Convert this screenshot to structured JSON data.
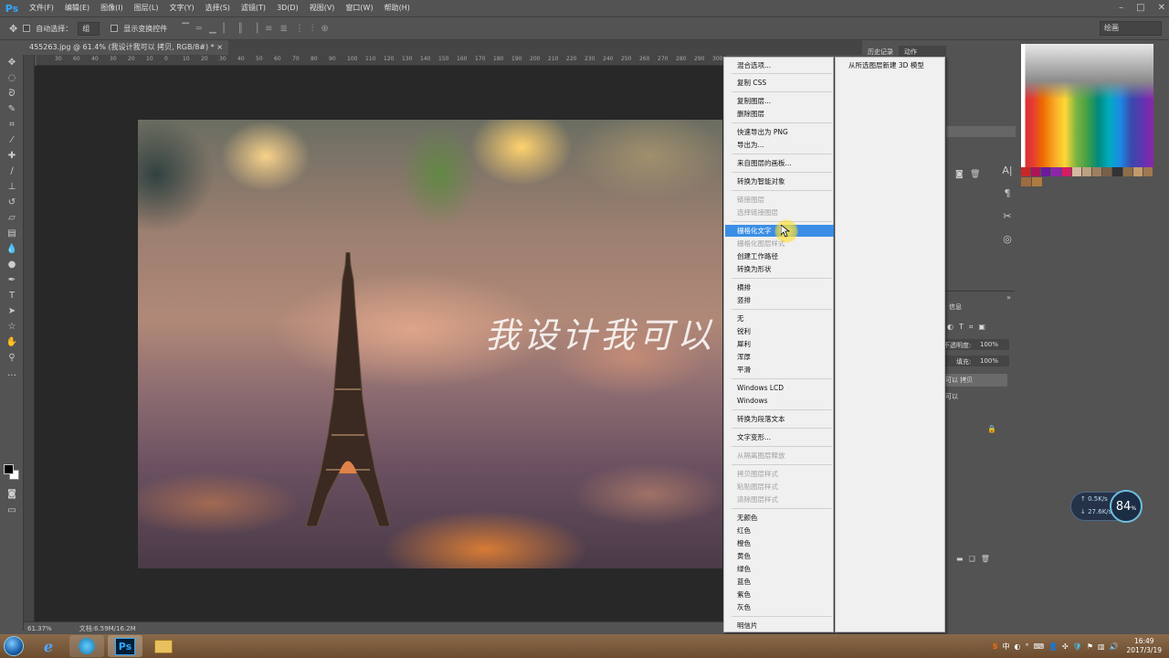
{
  "app": {
    "logo": "Ps"
  },
  "menubar": {
    "items": [
      "文件(F)",
      "编辑(E)",
      "图像(I)",
      "图层(L)",
      "文字(Y)",
      "选择(S)",
      "滤镜(T)",
      "3D(D)",
      "视图(V)",
      "窗口(W)",
      "帮助(H)"
    ]
  },
  "options": {
    "auto_select_label": "自动选择：",
    "auto_select_value": "组",
    "show_transform_label": "显示变换控件",
    "workspace_value": "绘画"
  },
  "document": {
    "tab_title": "455263.jpg @ 61.4% (我设计我可以 拷贝, RGB/8#) *",
    "text_layer": "我设计我可以"
  },
  "ruler": {
    "labels": [
      "30",
      "60",
      "40",
      "30",
      "20",
      "10",
      "0",
      "10",
      "20",
      "30",
      "40",
      "50",
      "60",
      "70",
      "80",
      "90",
      "100",
      "110",
      "120",
      "130",
      "140",
      "150",
      "160",
      "170",
      "180",
      "190",
      "200",
      "210",
      "220",
      "230",
      "240",
      "250",
      "260",
      "270",
      "280",
      "290",
      "300",
      "310",
      "320",
      "330",
      "340"
    ]
  },
  "status": {
    "zoom": "61.37%",
    "doc_size": "文档:6.59M/16.2M"
  },
  "panels": {
    "tab_history": "历史记录",
    "tab_actions": "动作",
    "layers_title": "信息",
    "opacity_label": "不透明度:",
    "opacity_value": "100%",
    "fill_label": "填充:",
    "fill_value": "100%",
    "layer_row_1": "可以 拷贝",
    "layer_row_2": "可以"
  },
  "context_menu": {
    "items": [
      {
        "label": "混合选项...",
        "enabled": true
      },
      {
        "label": "复制 CSS",
        "enabled": true
      },
      {
        "label": "复制图层...",
        "enabled": true
      },
      {
        "label": "删除图层",
        "enabled": true
      },
      {
        "label": "快速导出为 PNG",
        "enabled": true
      },
      {
        "label": "导出为...",
        "enabled": true
      },
      {
        "label": "来自图层的画板...",
        "enabled": true
      },
      {
        "label": "转换为智能对象",
        "enabled": true
      },
      {
        "label": "链接图层",
        "enabled": false
      },
      {
        "label": "选择链接图层",
        "enabled": false
      },
      {
        "label": "栅格化文字",
        "enabled": true,
        "highlighted": true
      },
      {
        "label": "栅格化图层样式",
        "enabled": false
      },
      {
        "label": "创建工作路径",
        "enabled": true
      },
      {
        "label": "转换为形状",
        "enabled": true
      },
      {
        "label": "横排",
        "enabled": true
      },
      {
        "label": "竖排",
        "enabled": true
      },
      {
        "label": "无",
        "enabled": true
      },
      {
        "label": "锐利",
        "enabled": true
      },
      {
        "label": "犀利",
        "enabled": true
      },
      {
        "label": "浑厚",
        "enabled": true
      },
      {
        "label": "平滑",
        "enabled": true
      },
      {
        "label": "Windows LCD",
        "enabled": true
      },
      {
        "label": "Windows",
        "enabled": true
      },
      {
        "label": "转换为段落文本",
        "enabled": true
      },
      {
        "label": "文字变形...",
        "enabled": true
      },
      {
        "label": "从隔离图层释放",
        "enabled": false
      },
      {
        "label": "拷贝图层样式",
        "enabled": false
      },
      {
        "label": "粘贴图层样式",
        "enabled": false
      },
      {
        "label": "清除图层样式",
        "enabled": false
      },
      {
        "label": "无颜色",
        "enabled": true
      },
      {
        "label": "红色",
        "enabled": true
      },
      {
        "label": "橙色",
        "enabled": true
      },
      {
        "label": "黄色",
        "enabled": true
      },
      {
        "label": "绿色",
        "enabled": true
      },
      {
        "label": "蓝色",
        "enabled": true
      },
      {
        "label": "紫色",
        "enabled": true
      },
      {
        "label": "灰色",
        "enabled": true
      },
      {
        "label": "明信片",
        "enabled": true
      }
    ]
  },
  "submenu": {
    "item": "从所选图层新建 3D 模型"
  },
  "net_widget": {
    "up": "0.5",
    "up_unit": "K/s",
    "down": "27.6",
    "down_unit": "K/s",
    "percent": "84",
    "percent_sign": "%"
  },
  "taskbar": {
    "ps_label": "Ps",
    "time": "16:49",
    "date": "2017/3/19",
    "ime": "中"
  },
  "colors": {
    "ps_blue": "#31a8ff",
    "menu_highlight": "#3a8ee6",
    "panel_bg": "#535353"
  }
}
